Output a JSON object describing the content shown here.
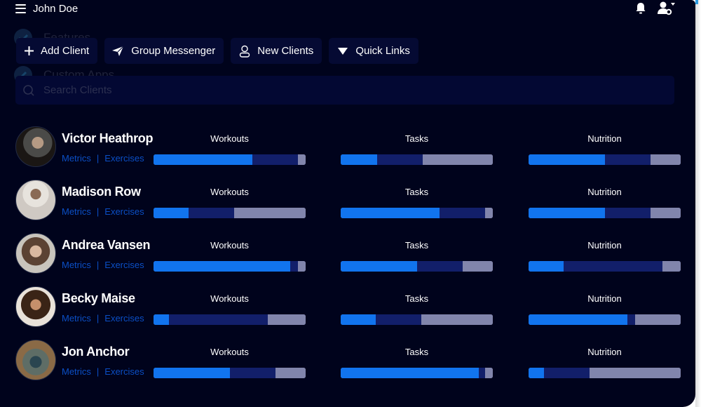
{
  "header": {
    "user_name": "John Doe",
    "menu_icon": "hamburger-menu-icon",
    "notifications_icon": "bell-icon",
    "account_icon": "user-settings-icon"
  },
  "ghost_sidebar": [
    {
      "label": "Features",
      "icon": "check-icon"
    },
    {
      "label": "Custom Apps",
      "icon": "pencil-icon"
    }
  ],
  "actions": [
    {
      "label": "Add Client",
      "icon": "plus-icon"
    },
    {
      "label": "Group Messenger",
      "icon": "send-icon"
    },
    {
      "label": "New Clients",
      "icon": "user-icon"
    },
    {
      "label": "Quick Links",
      "icon": "triangle-down-icon"
    }
  ],
  "search": {
    "placeholder": "Search Clients",
    "value": "",
    "icon": "search-icon"
  },
  "metric_labels": {
    "workouts": "Workouts",
    "tasks": "Tasks",
    "nutrition": "Nutrition"
  },
  "link_labels": {
    "metrics": "Metrics",
    "separator": "|",
    "exercises": "Exercises"
  },
  "colors": {
    "background": "#00031c",
    "button_bg": "#050a33",
    "done": "#1174ee",
    "in_progress": "#121f6a",
    "remaining": "#8185ac",
    "link": "#0b4fc6"
  },
  "clients": [
    {
      "name": "Victor Heathrop",
      "workouts": {
        "done": 65,
        "in_progress": 30,
        "remaining": 5
      },
      "tasks": {
        "done": 24,
        "in_progress": 30,
        "remaining": 46
      },
      "nutrition": {
        "done": 50,
        "in_progress": 30,
        "remaining": 20
      }
    },
    {
      "name": "Madison Row",
      "workouts": {
        "done": 23,
        "in_progress": 30,
        "remaining": 47
      },
      "tasks": {
        "done": 65,
        "in_progress": 30,
        "remaining": 5
      },
      "nutrition": {
        "done": 50,
        "in_progress": 30,
        "remaining": 20
      }
    },
    {
      "name": "Andrea Vansen",
      "workouts": {
        "done": 90,
        "in_progress": 5,
        "remaining": 5
      },
      "tasks": {
        "done": 50,
        "in_progress": 30,
        "remaining": 20
      },
      "nutrition": {
        "done": 23,
        "in_progress": 65,
        "remaining": 12
      }
    },
    {
      "name": "Becky Maise",
      "workouts": {
        "done": 10,
        "in_progress": 65,
        "remaining": 25
      },
      "tasks": {
        "done": 23,
        "in_progress": 30,
        "remaining": 47
      },
      "nutrition": {
        "done": 65,
        "in_progress": 5,
        "remaining": 30
      }
    },
    {
      "name": "Jon Anchor",
      "workouts": {
        "done": 50,
        "in_progress": 30,
        "remaining": 20
      },
      "tasks": {
        "done": 91,
        "in_progress": 4,
        "remaining": 5
      },
      "nutrition": {
        "done": 10,
        "in_progress": 30,
        "remaining": 60
      }
    }
  ]
}
